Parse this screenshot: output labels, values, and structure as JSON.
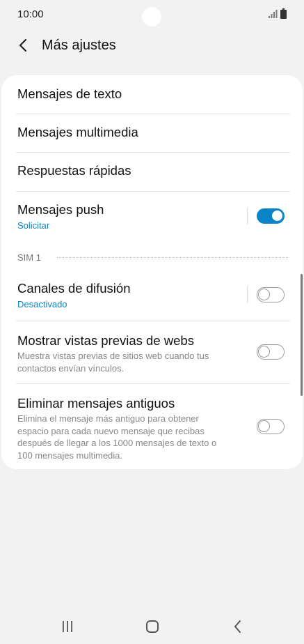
{
  "status": {
    "time": "10:00"
  },
  "header": {
    "title": "Más ajustes"
  },
  "items": {
    "text_messages": {
      "title": "Mensajes de texto"
    },
    "multimedia_messages": {
      "title": "Mensajes multimedia"
    },
    "quick_responses": {
      "title": "Respuestas rápidas"
    },
    "push_messages": {
      "title": "Mensajes push",
      "subtitle": "Solicitar",
      "enabled": true
    },
    "section": {
      "label": "SIM 1"
    },
    "broadcast": {
      "title": "Canales de difusión",
      "subtitle": "Desactivado",
      "enabled": false
    },
    "web_previews": {
      "title": "Mostrar vistas previas de webs",
      "description_line1": "Muestra vistas previas de sitios web cuando tus",
      "description_line2": "contactos envían vínculos.",
      "enabled": false
    },
    "delete_old": {
      "title": "Eliminar mensajes antiguos",
      "description_line1": "Elimina el mensaje más antiguo para obtener",
      "description_line2": "espacio para cada nuevo mensaje que recibas",
      "description_line3": "después de llegar a los 1000 mensajes de texto o",
      "description_line4": "100 mensajes multimedia.",
      "enabled": false
    }
  },
  "colors": {
    "accent": "#0a84c6",
    "background": "#f2f2f2",
    "card": "#ffffff"
  },
  "navbar": {
    "icons": [
      "recent-apps-icon",
      "home-icon",
      "back-icon"
    ]
  }
}
